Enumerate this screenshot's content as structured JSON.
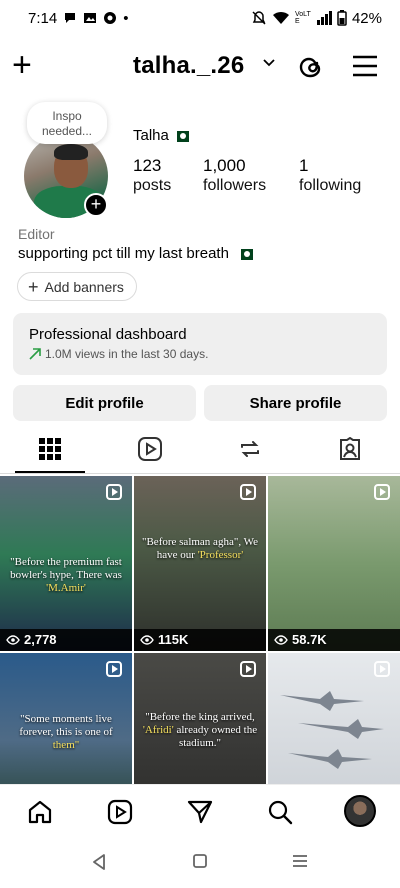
{
  "status_bar": {
    "time": "7:14",
    "dot": "•",
    "battery": "42%",
    "network": "VoLTE"
  },
  "header": {
    "username": "talha._.26"
  },
  "profile": {
    "note": "Inspo needed...",
    "name": "Talha",
    "stats": [
      {
        "value": "123",
        "label": "posts"
      },
      {
        "value": "1,000",
        "label": "followers"
      },
      {
        "value": "1",
        "label": "following"
      }
    ],
    "category": "Editor",
    "bio": "supporting pct till my last breath"
  },
  "add_banners": "Add banners",
  "dashboard": {
    "title": "Professional dashboard",
    "subtitle": "1.0M views in the last 30 days."
  },
  "buttons": {
    "edit": "Edit profile",
    "share": "Share profile"
  },
  "grid": [
    {
      "caption_pre": "\"Before the premium fast bowler's hype, There was",
      "caption_hl": "'M.Amir'",
      "views": "2,778",
      "bg": "#3b4a5a"
    },
    {
      "caption_pre": "\"Before salman agha\", We have our",
      "caption_hl": "'Professor'",
      "views": "115K",
      "bg": "#4a5a48"
    },
    {
      "caption_pre": "",
      "caption_hl": "",
      "views": "58.7K",
      "bg": "#6d8a6a"
    },
    {
      "caption_pre": "\"Some moments live forever, this is one of",
      "caption_hl": "them\"",
      "views": "",
      "bg": "#4f6b86"
    },
    {
      "caption_pre": "\"Before the king arrived,",
      "caption_hl": "'Afridi'",
      "caption_post": "already owned the stadium.\"",
      "views": "",
      "bg": "#3a3a38"
    },
    {
      "caption_pre": "",
      "caption_hl": "",
      "views": "",
      "bg": "#c8cdd3"
    }
  ],
  "colors": {
    "accent_green": "#2a9d44",
    "button_bg": "#efefef"
  }
}
